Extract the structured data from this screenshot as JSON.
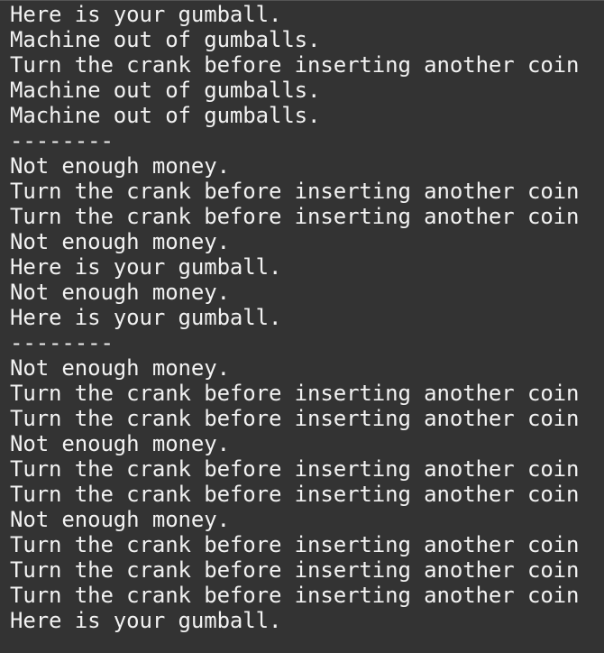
{
  "console": {
    "background": "#333333",
    "text_color": "#f2f2f2",
    "lines": [
      "Here is your gumball.",
      "Machine out of gumballs.",
      "Turn the crank before inserting another coin",
      "Machine out of gumballs.",
      "Machine out of gumballs.",
      "--------",
      "Not enough money.",
      "Turn the crank before inserting another coin",
      "Turn the crank before inserting another coin",
      "Not enough money.",
      "Here is your gumball.",
      "Not enough money.",
      "Here is your gumball.",
      "--------",
      "Not enough money.",
      "Turn the crank before inserting another coin",
      "Turn the crank before inserting another coin",
      "Not enough money.",
      "Turn the crank before inserting another coin",
      "Turn the crank before inserting another coin",
      "Not enough money.",
      "Turn the crank before inserting another coin",
      "Turn the crank before inserting another coin",
      "Turn the crank before inserting another coin",
      "Here is your gumball."
    ]
  }
}
